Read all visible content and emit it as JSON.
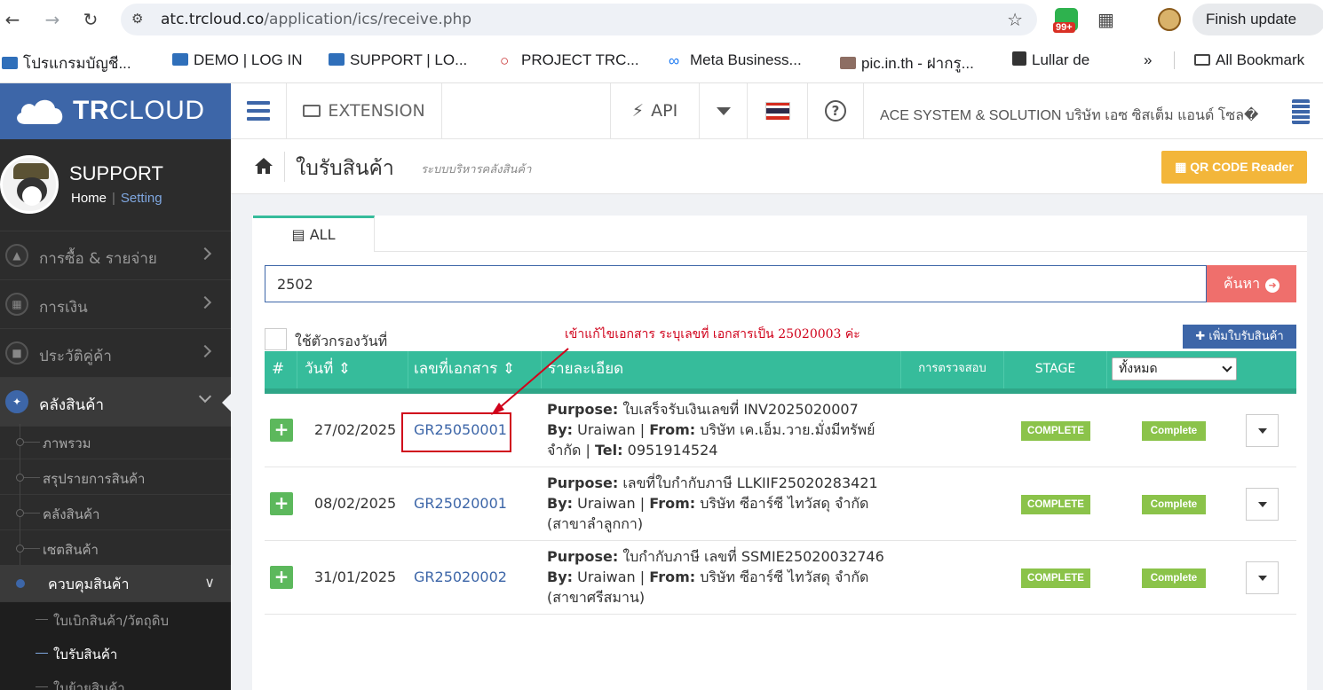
{
  "browser": {
    "url_host": "atc.trcloud.co",
    "url_path": "/application/ics/receive.php",
    "ext_badge": "99+",
    "finish_update": "Finish update",
    "bookmarks": [
      "โปรแกรมบัญชี...",
      "DEMO | LOG IN",
      "SUPPORT | LO...",
      "PROJECT TRC...",
      "Meta Business...",
      "pic.in.th - ฝากรู...",
      "Lullar de",
      "»",
      "All Bookmark"
    ]
  },
  "header": {
    "logo_bold": "TR",
    "logo_rest": "CLOUD",
    "extension": "EXTENSION",
    "api": "API",
    "help": "?",
    "company": "ACE SYSTEM & SOLUTION บริษัท เอซ ซิสเต็ม แอนด์ โซล�",
    "brand_color": "#3d66a8"
  },
  "sidebar": {
    "user": "SUPPORT",
    "home": "Home",
    "sep": "|",
    "setting": "Setting",
    "menu": [
      {
        "label": "การซื้อ & รายจ่าย",
        "icon": "cart-icon"
      },
      {
        "label": "การเงิน",
        "icon": "calendar-icon"
      },
      {
        "label": "ประวัติคู่ค้า",
        "icon": "contact-icon"
      },
      {
        "label": "คลังสินค้า",
        "icon": "cubes-icon"
      }
    ],
    "sub": [
      "ภาพรวม",
      "สรุปรายการสินค้า",
      "คลังสินค้า",
      "เซตสินค้า",
      "ควบคุมสินค้า"
    ],
    "sub2": [
      "ใบเบิกสินค้า/วัตถุดิบ",
      "ใบรับสินค้า",
      "ใบย้ายสินค้า"
    ]
  },
  "page": {
    "title": "ใบรับสินค้า",
    "subtitle": "ระบบบริหารคลังสินค้า",
    "qr": "QR CODE Reader"
  },
  "tab_all": "ALL",
  "search": {
    "value": "2502",
    "button": "ค้นหา"
  },
  "date_filter_label": "ใช้ตัวกรองวันที่",
  "annotation": "เข้าแก้ไขเอกสาร ระบุเลขที่ เอกสารเป็น 25020003 ค่ะ",
  "add_button": "เพิ่มใบรับสินค้า",
  "table": {
    "headers": {
      "num": "#",
      "date": "วันที่",
      "doc": "เลขที่เอกสาร",
      "detail": "รายละเอียด",
      "check": "การตรวจสอบ",
      "stage": "STAGE",
      "filter": "ทั้งหมด"
    },
    "rows": [
      {
        "date": "27/02/2025",
        "doc": "GR25050001",
        "purpose": "ใบเสร็จรับเงินเลขที่ INV2025020007",
        "by": "Uraiwan",
        "from": "บริษัท เค.เอ็ม.วาย.มั่งมีทรัพย์",
        "tail_prefix": "จำกัด",
        "tel_label": "Tel:",
        "tel": "0951914524",
        "check": "COMPLETE",
        "stage": "Complete"
      },
      {
        "date": "08/02/2025",
        "doc": "GR25020001",
        "purpose": "เลขที่ใบกำกับภาษี LLKIIF25020283421",
        "by": "Uraiwan",
        "from": "บริษัท ซีอาร์ซี ไทวัสดุ จำกัด",
        "tail": "(สาขาลำลูกกา)",
        "check": "COMPLETE",
        "stage": "Complete"
      },
      {
        "date": "31/01/2025",
        "doc": "GR25020002",
        "purpose": "ใบกำกับภาษี เลขที่ SSMIE25020032746",
        "by": "Uraiwan",
        "from": "บริษัท ซีอาร์ซี ไทวัสดุ จำกัด",
        "tail": "(สาขาศรีสมาน)",
        "check": "COMPLETE",
        "stage": "Complete"
      }
    ]
  },
  "labels": {
    "purpose": "Purpose:",
    "by": "By:",
    "from": "From:",
    "pipe": "|"
  }
}
